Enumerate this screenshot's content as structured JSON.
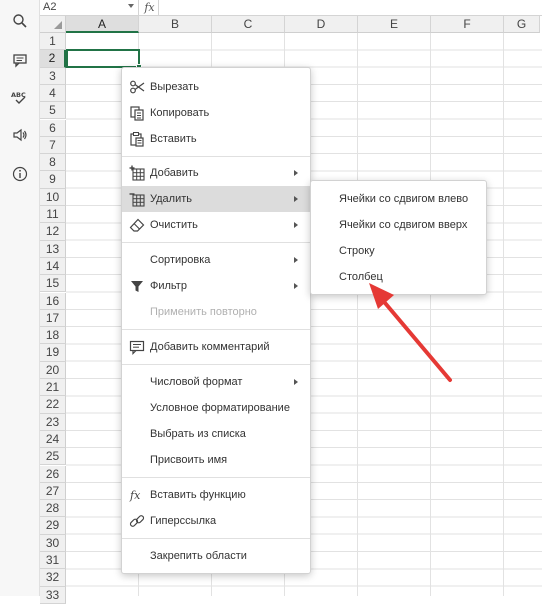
{
  "formula_bar": {
    "name_box": "A2",
    "fx": "fx"
  },
  "columns": [
    "A",
    "B",
    "C",
    "D",
    "E",
    "F",
    "G"
  ],
  "selected_column": "A",
  "rows": [
    "1",
    "2",
    "3",
    "4",
    "5",
    "6",
    "7",
    "8",
    "9",
    "10",
    "11",
    "12",
    "13",
    "14",
    "15",
    "16",
    "17",
    "18",
    "19",
    "20",
    "21",
    "22",
    "23",
    "24",
    "25",
    "26",
    "27",
    "28",
    "29",
    "30",
    "31",
    "32",
    "33"
  ],
  "selected_row": "2",
  "context_menu": {
    "items": [
      {
        "label": "Вырезать",
        "icon": "scissors-icon"
      },
      {
        "label": "Копировать",
        "icon": "copy-icon"
      },
      {
        "label": "Вставить",
        "icon": "paste-icon"
      },
      {
        "label": "Добавить",
        "icon": "insert-cells-icon",
        "submenu": true
      },
      {
        "label": "Удалить",
        "icon": "delete-cells-icon",
        "submenu": true,
        "highlighted": true
      },
      {
        "label": "Очистить",
        "icon": "eraser-icon",
        "submenu": true
      },
      {
        "label": "Сортировка",
        "submenu": true
      },
      {
        "label": "Фильтр",
        "icon": "filter-icon",
        "submenu": true
      },
      {
        "label": "Применить повторно",
        "disabled": true
      },
      {
        "label": "Добавить комментарий",
        "icon": "comment-icon"
      },
      {
        "label": "Числовой формат",
        "submenu": true
      },
      {
        "label": "Условное форматирование"
      },
      {
        "label": "Выбрать из списка"
      },
      {
        "label": "Присвоить имя"
      },
      {
        "label": "Вставить функцию",
        "icon": "function-icon"
      },
      {
        "label": "Гиперссылка",
        "icon": "link-icon"
      },
      {
        "label": "Закрепить области"
      }
    ]
  },
  "submenu": {
    "items": [
      {
        "label": "Ячейки со сдвигом влево"
      },
      {
        "label": "Ячейки со сдвигом вверх"
      },
      {
        "label": "Строку"
      },
      {
        "label": "Столбец"
      }
    ]
  },
  "colors": {
    "accent": "#217346",
    "annotation": "#e53935",
    "highlight": "#dcdcdc"
  }
}
